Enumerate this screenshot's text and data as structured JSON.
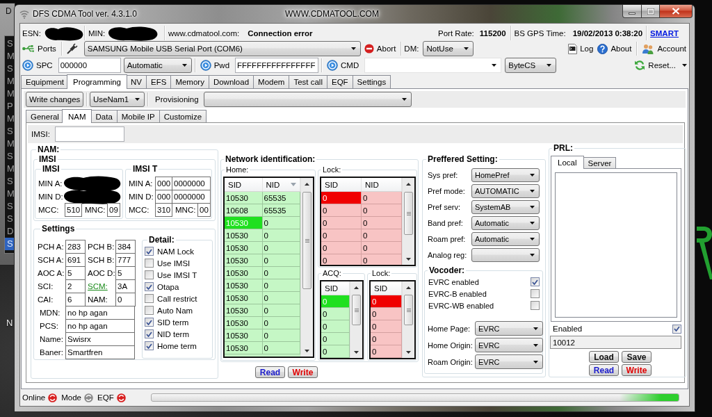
{
  "background_window": {
    "title": "D",
    "items": [
      {
        "text": "S",
        "selected": false
      },
      {
        "text": "M",
        "selected": false
      },
      {
        "text": "S",
        "selected": false
      },
      {
        "text": "M",
        "selected": false
      },
      {
        "text": "M",
        "selected": false
      },
      {
        "text": "P",
        "selected": false
      },
      {
        "text": "M",
        "selected": false
      },
      {
        "text": "S",
        "selected": false
      },
      {
        "text": "M",
        "selected": false
      },
      {
        "text": "S",
        "selected": false
      },
      {
        "text": "M",
        "selected": false
      },
      {
        "text": "S",
        "selected": false
      },
      {
        "text": "M",
        "selected": false
      },
      {
        "text": "S",
        "selected": false
      },
      {
        "text": "S",
        "selected": false
      },
      {
        "text": "D",
        "selected": false
      },
      {
        "text": "S",
        "selected": true
      }
    ]
  },
  "desktop": {
    "icon_label": "N"
  },
  "window": {
    "title": "DFS CDMA Tool ver. 4.3.1.0",
    "site": "WWW.CDMATOOL.COM"
  },
  "info_bar": {
    "esn": {
      "label": "ESN:",
      "redacted": true
    },
    "min": {
      "label": "MIN:",
      "redacted": true
    },
    "server": {
      "label": "www.cdmatool.com:",
      "status": "Connection error"
    },
    "port_rate": {
      "label": "Port Rate:",
      "value": "115200"
    },
    "gps_time": {
      "label": "BS GPS Time:",
      "value": "19/02/2013 0:38:20"
    },
    "link": "SMART"
  },
  "toolbar": {
    "ports_button": "Ports",
    "port_select": "SAMSUNG Mobile USB Serial Port (COM6)",
    "abort_button": "Abort",
    "dm_label": "DM:",
    "dm_select": "NotUse",
    "log_button": "Log",
    "about_button": "About",
    "account_button": "Account"
  },
  "command_bar": {
    "spc_button": "SPC",
    "spc_value": "000000",
    "spc_mode": "Automatic",
    "pwd_button": "Pwd",
    "pwd_value": "FFFFFFFFFFFFFFFF",
    "cmd_button": "CMD",
    "cmd_format": "ByteCS",
    "reset_button": "Reset..."
  },
  "tabs": [
    {
      "label": "Equipment",
      "selected": false
    },
    {
      "label": "Programming",
      "selected": true
    },
    {
      "label": "NV",
      "selected": false
    },
    {
      "label": "EFS",
      "selected": false
    },
    {
      "label": "Memory",
      "selected": false
    },
    {
      "label": "Download",
      "selected": false
    },
    {
      "label": "Modem",
      "selected": false
    },
    {
      "label": "Test call",
      "selected": false
    },
    {
      "label": "EQF",
      "selected": false
    },
    {
      "label": "Settings",
      "selected": false
    }
  ],
  "programming_bar": {
    "write_button": "Write changes",
    "nam_select": "UseNam1",
    "provisioning_label": "Provisioning"
  },
  "subtabs": [
    {
      "label": "General",
      "selected": false
    },
    {
      "label": "NAM",
      "selected": true
    },
    {
      "label": "Data",
      "selected": false
    },
    {
      "label": "Mobile IP",
      "selected": false
    },
    {
      "label": "Customize",
      "selected": false
    }
  ],
  "imsi_field": {
    "label": "IMSI:"
  },
  "nam": {
    "title": "NAM:",
    "imsi_group": {
      "title": "IMSI",
      "sets": [
        {
          "title": "IMSI",
          "rows": [
            {
              "label": "MIN A:",
              "redacted": true
            },
            {
              "label": "MIN D:",
              "redacted": true
            }
          ],
          "mcc": {
            "label": "MCC:",
            "value": "510"
          },
          "mnc": {
            "label": "MNC:",
            "value": "09"
          }
        },
        {
          "title": "IMSI T",
          "rows": [
            {
              "label": "MIN A:",
              "prefix": "000",
              "number": "0000000",
              "redacted": false
            },
            {
              "label": "MIN D:",
              "prefix": "000",
              "number": "0000000",
              "redacted": false
            }
          ],
          "mcc": {
            "label": "MCC:",
            "value": "310"
          },
          "mnc": {
            "label": "MNC:",
            "value": "00"
          }
        }
      ]
    },
    "settings": {
      "title": "Settings",
      "rows": [
        {
          "left": {
            "label": "PCH A:",
            "value": "283",
            "kind": "text"
          },
          "right": {
            "label": "PCH B:",
            "value": "384",
            "kind": "text"
          }
        },
        {
          "left": {
            "label": "SCH A:",
            "value": "691",
            "kind": "text"
          },
          "right": {
            "label": "SCH B:",
            "value": "777",
            "kind": "text"
          }
        },
        {
          "left": {
            "label": "AOC A:",
            "value": "5",
            "kind": "text"
          },
          "right": {
            "label": "AOC D:",
            "value": "5",
            "kind": "text"
          }
        },
        {
          "left": {
            "label": "SCI:",
            "value": "2",
            "kind": "text"
          },
          "right": {
            "label": "SCM:",
            "value": "3A",
            "kind": "link"
          }
        },
        {
          "left": {
            "label": "CAI:",
            "value": "6",
            "kind": "text"
          },
          "right": {
            "label": "NAM:",
            "value": "0",
            "kind": "text"
          }
        }
      ],
      "fields": [
        {
          "label": "MDN:",
          "value": "no hp agan"
        },
        {
          "label": "PCS:",
          "value": "no hp agan"
        },
        {
          "label": "Name:",
          "value": "Swisrx"
        },
        {
          "label": "Baner:",
          "value": "Smartfren"
        }
      ]
    },
    "detail": {
      "title": "Detail:",
      "options": [
        {
          "label": "NAM Lock",
          "checked": true
        },
        {
          "label": "Use IMSI",
          "checked": false
        },
        {
          "label": "Use IMSI T",
          "checked": false
        },
        {
          "label": "Otapa",
          "checked": true
        },
        {
          "label": "Call restrict",
          "checked": false
        },
        {
          "label": "Auto Nam",
          "checked": false
        },
        {
          "label": "SID term",
          "checked": true
        },
        {
          "label": "NID term",
          "checked": true
        },
        {
          "label": "Home term",
          "checked": true
        }
      ]
    }
  },
  "network": {
    "title": "Network identification:",
    "tables": [
      {
        "title": "Home:",
        "kind": "allowed",
        "columns": [
          {
            "label": "SID",
            "sorted": false
          },
          {
            "label": "NID",
            "sorted": true
          }
        ],
        "rows": [
          {
            "cells": [
              "10530",
              "65535"
            ],
            "selected": false
          },
          {
            "cells": [
              "10608",
              "65535"
            ],
            "selected": false
          },
          {
            "cells": [
              "10530",
              "0"
            ],
            "selected": true
          },
          {
            "cells": [
              "10530",
              "0"
            ],
            "selected": false
          },
          {
            "cells": [
              "10530",
              "0"
            ],
            "selected": false
          },
          {
            "cells": [
              "10530",
              "0"
            ],
            "selected": false
          },
          {
            "cells": [
              "10530",
              "0"
            ],
            "selected": false
          },
          {
            "cells": [
              "10530",
              "0"
            ],
            "selected": false
          },
          {
            "cells": [
              "10530",
              "0"
            ],
            "selected": false
          },
          {
            "cells": [
              "10530",
              "0"
            ],
            "selected": false
          },
          {
            "cells": [
              "10530",
              "0"
            ],
            "selected": false
          },
          {
            "cells": [
              "10530",
              "0"
            ],
            "selected": false
          },
          {
            "cells": [
              "10530",
              "0"
            ],
            "selected": false
          }
        ]
      },
      {
        "title": "Lock:",
        "kind": "blocked",
        "columns": [
          {
            "label": "SID",
            "sorted": false
          },
          {
            "label": "NID",
            "sorted": false
          }
        ],
        "rows": [
          {
            "cells": [
              "0",
              "0"
            ],
            "selected": true
          },
          {
            "cells": [
              "0",
              "0"
            ],
            "selected": false
          },
          {
            "cells": [
              "0",
              "0"
            ],
            "selected": false
          },
          {
            "cells": [
              "0",
              "0"
            ],
            "selected": false
          },
          {
            "cells": [
              "0",
              "0"
            ],
            "selected": false
          },
          {
            "cells": [
              "0",
              "0"
            ],
            "selected": false
          }
        ]
      },
      {
        "title": "ACQ:",
        "kind": "allowed",
        "columns": [
          {
            "label": "SID",
            "sorted": false
          }
        ],
        "rows": [
          {
            "cells": [
              "0"
            ],
            "selected": true
          },
          {
            "cells": [
              "0"
            ],
            "selected": false
          },
          {
            "cells": [
              "0"
            ],
            "selected": false
          },
          {
            "cells": [
              "0"
            ],
            "selected": false
          },
          {
            "cells": [
              "0"
            ],
            "selected": false
          }
        ]
      },
      {
        "title": "Lock:",
        "kind": "blocked",
        "columns": [
          {
            "label": "SID",
            "sorted": false
          }
        ],
        "rows": [
          {
            "cells": [
              "0"
            ],
            "selected": true
          },
          {
            "cells": [
              "0"
            ],
            "selected": false
          },
          {
            "cells": [
              "0"
            ],
            "selected": false
          },
          {
            "cells": [
              "0"
            ],
            "selected": false
          },
          {
            "cells": [
              "0"
            ],
            "selected": false
          }
        ]
      }
    ],
    "buttons": [
      {
        "label": "Read",
        "kind": "read"
      },
      {
        "label": "Write",
        "kind": "write"
      }
    ]
  },
  "preferred": {
    "title": "Preffered Setting:",
    "selects": [
      {
        "label": "Sys pref:",
        "value": "HomePref"
      },
      {
        "label": "Pref mode:",
        "value": "AUTOMATIC"
      },
      {
        "label": "Pref serv:",
        "value": "SystemAB"
      },
      {
        "label": "Band pref:",
        "value": "Automatic"
      },
      {
        "label": "Roam pref:",
        "value": "Automatic"
      },
      {
        "label": "Analog reg:"
      }
    ],
    "vocoder": {
      "title": "Vocoder:",
      "options": [
        {
          "label": "EVRC enabled",
          "checked": true
        },
        {
          "label": "EVRC-B enabled",
          "checked": false
        },
        {
          "label": "EVRC-WB enabled",
          "checked": false
        }
      ],
      "selects": [
        {
          "label": "Home Page:",
          "value": "EVRC"
        },
        {
          "label": "Home Origin:",
          "value": "EVRC"
        },
        {
          "label": "Roam Origin:",
          "value": "EVRC"
        }
      ]
    }
  },
  "prl": {
    "title": "PRL:",
    "tabs": [
      {
        "label": "Local",
        "selected": true
      },
      {
        "label": "Server",
        "selected": false
      }
    ],
    "enabled": {
      "label": "Enabled",
      "checked": true
    },
    "value": "10012",
    "buttons": [
      {
        "label": "Load",
        "kind": "load"
      },
      {
        "label": "Save",
        "kind": "save"
      },
      {
        "label": "Read",
        "kind": "read"
      },
      {
        "label": "Write",
        "kind": "write"
      }
    ]
  },
  "status_bar": {
    "indicators": [
      {
        "label": "Online",
        "on": true
      },
      {
        "label": "Mode",
        "on": false
      },
      {
        "label": "EQF",
        "on": true
      }
    ],
    "progress": {
      "kind": "marquee"
    }
  }
}
